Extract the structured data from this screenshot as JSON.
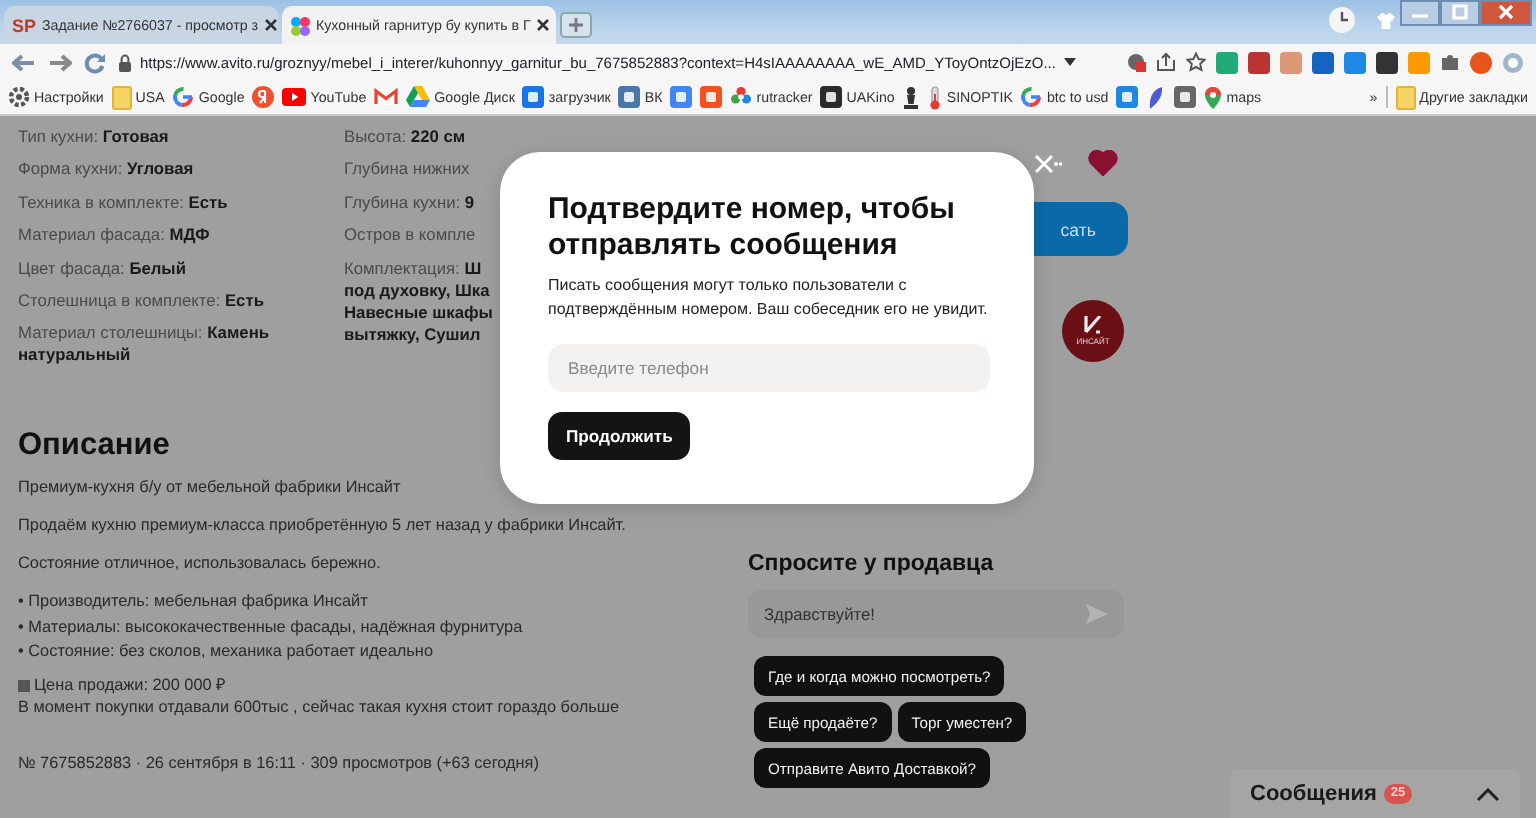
{
  "browser": {
    "tabs": [
      {
        "favicon": "SP",
        "title": "Задание №2766037 - просмотр з",
        "selected": false
      },
      {
        "title": "Кухонный гарнитур бу купить в Г",
        "selected": true
      }
    ],
    "url": "https://www.avito.ru/groznyy/mebel_i_interer/kuhonnyy_garnitur_bu_7675852883?context=H4sIAAAAAAAA_wE_AMD_YToyOntzOjEzO...",
    "bookmarks": [
      {
        "kind": "gear",
        "label": "Настройки"
      },
      {
        "kind": "folder",
        "label": "USA"
      },
      {
        "kind": "google",
        "label": "Google"
      },
      {
        "kind": "yandex"
      },
      {
        "kind": "youtube",
        "label": "YouTube"
      },
      {
        "kind": "gmail"
      },
      {
        "kind": "drive",
        "label": "Google Диск"
      },
      {
        "kind": "square",
        "color": "#1a73e8",
        "label": "загрузчик"
      },
      {
        "kind": "square",
        "color": "#4a76a8",
        "label": "ВК"
      },
      {
        "kind": "square",
        "color": "#4285f4"
      },
      {
        "kind": "square",
        "color": "#f4511e"
      },
      {
        "kind": "flower",
        "label": "rutracker"
      },
      {
        "kind": "square",
        "color": "#2b2b2b",
        "label": "UAKino"
      },
      {
        "kind": "chess"
      },
      {
        "kind": "thermo",
        "label": "SINOPTIK"
      },
      {
        "kind": "google",
        "label": "btc to usd"
      },
      {
        "kind": "square",
        "color": "#1e88e5"
      },
      {
        "kind": "feather"
      },
      {
        "kind": "square",
        "color": "#666666"
      },
      {
        "kind": "pin",
        "label": "maps"
      }
    ],
    "more": "»",
    "other_bookmarks": "Другие закладки"
  },
  "listing": {
    "params_left": [
      {
        "label": "Тип кухни:",
        "value": "Готовая"
      },
      {
        "label": "Форма кухни:",
        "value": "Угловая"
      },
      {
        "label": "Техника в комплекте:",
        "value": "Есть"
      },
      {
        "label": "Материал фасада:",
        "value": "МДФ"
      },
      {
        "label": "Цвет фасада:",
        "value": "Белый"
      },
      {
        "label": "Столешница в комплекте:",
        "value": "Есть"
      },
      {
        "label": "Материал столешницы:",
        "value": "Камень натуральный"
      }
    ],
    "params_right": [
      {
        "label": "Высота:",
        "value": "220 см"
      },
      {
        "label": "Глубина нижних"
      },
      {
        "label": "Глубина кухни:",
        "value": "9"
      },
      {
        "label": "Остров в компле"
      },
      {
        "label": "Комплектация:",
        "value": "Ш",
        "lines": [
          "под духовку, Шка",
          "Навесные шкафы",
          "вытяжку, Сушил"
        ]
      }
    ],
    "description": {
      "heading": "Описание",
      "paragraphs": [
        "Премиум-кухня б/у от мебельной фабрики Инсайт",
        "Продаём кухню премиум-класса приобретённую 5 лет назад у фабрики Инсайт.",
        "Состояние отличное, использовалась бережно."
      ],
      "bullets": [
        "• Производитель: мебельная фабрика Инсайт",
        "• Материалы: высококачественные фасады, надёжная фурнитура",
        "• Состояние: без сколов, механика работает идеально"
      ],
      "price": "Цена продажи: 200 000 ₽",
      "note": "В момент покупки отдавали 600тыс , сейчас такая кухня стоит гораздо больше"
    },
    "meta": "№ 7675852883 · 26 сентября в 16:11 · 309 просмотров (+63 сегодня)"
  },
  "seller": {
    "favorite": true,
    "button": "сать",
    "logo_text": "ИНСАЙТ"
  },
  "chat": {
    "heading": "Спросите у продавца",
    "message": "Здравствуйте!",
    "quick_replies": [
      [
        "Где и когда можно посмотреть?"
      ],
      [
        "Ещё продаёте?",
        "Торг уместен?"
      ],
      [
        "Отправите Авито Доставкой?"
      ]
    ]
  },
  "messages_bar": {
    "label": "Сообщения",
    "badge": "25",
    "expanded": false
  },
  "modal": {
    "title": "Подтвердите номер, чтобы отправлять сообщения",
    "text": "Писать сообщения могут только пользователи с подтверждённым номером. Ваш собеседник его не увидит.",
    "placeholder": "Введите телефон",
    "button": "Продолжить"
  }
}
